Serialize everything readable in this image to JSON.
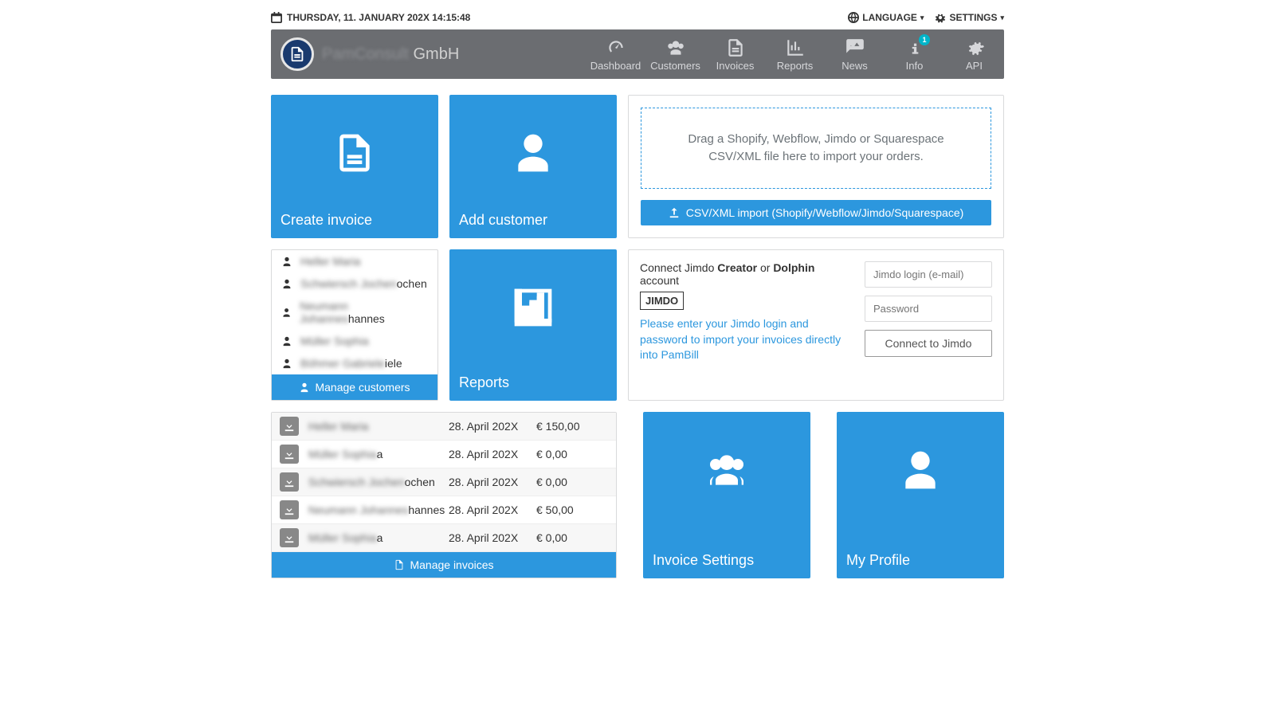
{
  "topbar": {
    "date": "THURSDAY, 11. JANUARY 202X 14:15:48",
    "language": "LANGUAGE",
    "settings": "SETTINGS"
  },
  "brand": {
    "blurred": "PamConsult",
    "suffix": "GmbH"
  },
  "nav": {
    "dashboard": "Dashboard",
    "customers": "Customers",
    "invoices": "Invoices",
    "reports": "Reports",
    "news": "News",
    "info": "Info",
    "info_badge": "1",
    "api": "API"
  },
  "tiles": {
    "create_invoice": "Create invoice",
    "add_customer": "Add customer",
    "reports": "Reports",
    "invoice_settings": "Invoice Settings",
    "my_profile": "My Profile"
  },
  "import": {
    "dropzone": "Drag a Shopify, Webflow, Jimdo or Squarespace CSV/XML file here to import your orders.",
    "button": "CSV/XML import (Shopify/Webflow/Jimdo/Squarespace)"
  },
  "customers": [
    "Heller  Maria",
    "Schwiersch  Jochen",
    "Neumann  Johannes",
    "Müller  Sophia",
    "Böhmer  Gabriele"
  ],
  "customers_visible_suffix": [
    "",
    "ochen",
    "hannes",
    "",
    "iele"
  ],
  "manage_customers": "Manage customers",
  "jimdo": {
    "line1_pre": "Connect Jimdo ",
    "creator": "Creator",
    "or": " or ",
    "dolphin": "Dolphin",
    "line1_post": " account",
    "logo": "JIMDO",
    "hint": "Please enter your Jimdo login and password to import your invoices directly into PamBill",
    "login_placeholder": "Jimdo login (e-mail)",
    "password_placeholder": "Password",
    "connect_button": "Connect to Jimdo"
  },
  "invoices": [
    {
      "name": "Heller Maria",
      "suffix": "",
      "date": "28. April 202X",
      "amount": "€ 150,00"
    },
    {
      "name": "Müller Sophia",
      "suffix": "a",
      "date": "28. April 202X",
      "amount": "€ 0,00"
    },
    {
      "name": "Schwiersch Jochen",
      "suffix": "ochen",
      "date": "28. April 202X",
      "amount": "€ 0,00"
    },
    {
      "name": "Neumann Johannes",
      "suffix": "hannes",
      "date": "28. April 202X",
      "amount": "€ 50,00"
    },
    {
      "name": "Müller Sophia",
      "suffix": "a",
      "date": "28. April 202X",
      "amount": "€ 0,00"
    }
  ],
  "manage_invoices": "Manage invoices"
}
